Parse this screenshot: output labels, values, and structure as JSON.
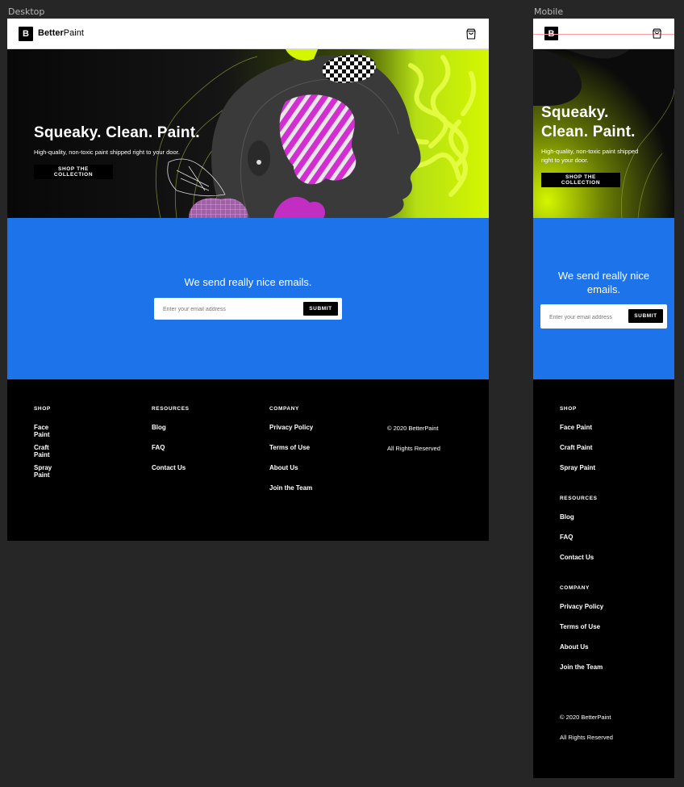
{
  "frames": {
    "desktop_label": "Desktop",
    "mobile_label": "Mobile"
  },
  "brand": {
    "logo_letter": "B",
    "name_bold": "Better",
    "name_regular": "Paint"
  },
  "icons": {
    "cart": "shopping-bag-icon",
    "logo": "brand-logo-icon"
  },
  "colors": {
    "accent_blue": "#1c73ea",
    "hero_lime": "#c9f20a",
    "magenta": "#d22ed2",
    "black": "#000000"
  },
  "hero": {
    "title": "Squeaky. Clean. Paint.",
    "mobile_title_line1": "Squeaky.",
    "mobile_title_line2": "Clean. Paint.",
    "subtitle": "High-quality, non-toxic paint shipped right to your door.",
    "mobile_subtitle_line1": "High-quality, non-toxic paint shipped",
    "mobile_subtitle_line2": "right to your door.",
    "cta": "SHOP THE COLLECTION"
  },
  "newsletter": {
    "title": "We send really nice emails.",
    "mobile_title_line1": "We send really nice",
    "mobile_title_line2": "emails.",
    "placeholder": "Enter your email address",
    "submit": "SUBMIT"
  },
  "footer": {
    "shop": {
      "heading": "SHOP",
      "links": [
        "Face Paint",
        "Craft Paint",
        "Spray Paint"
      ]
    },
    "resources": {
      "heading": "RESOURCES",
      "links": [
        "Blog",
        "FAQ",
        "Contact Us"
      ]
    },
    "company": {
      "heading": "COMPANY",
      "links": [
        "Privacy Policy",
        "Terms of Use",
        "About Us",
        "Join the Team"
      ]
    },
    "copyright": "© 2020 BetterPaint",
    "rights": "All Rights Reserved"
  }
}
